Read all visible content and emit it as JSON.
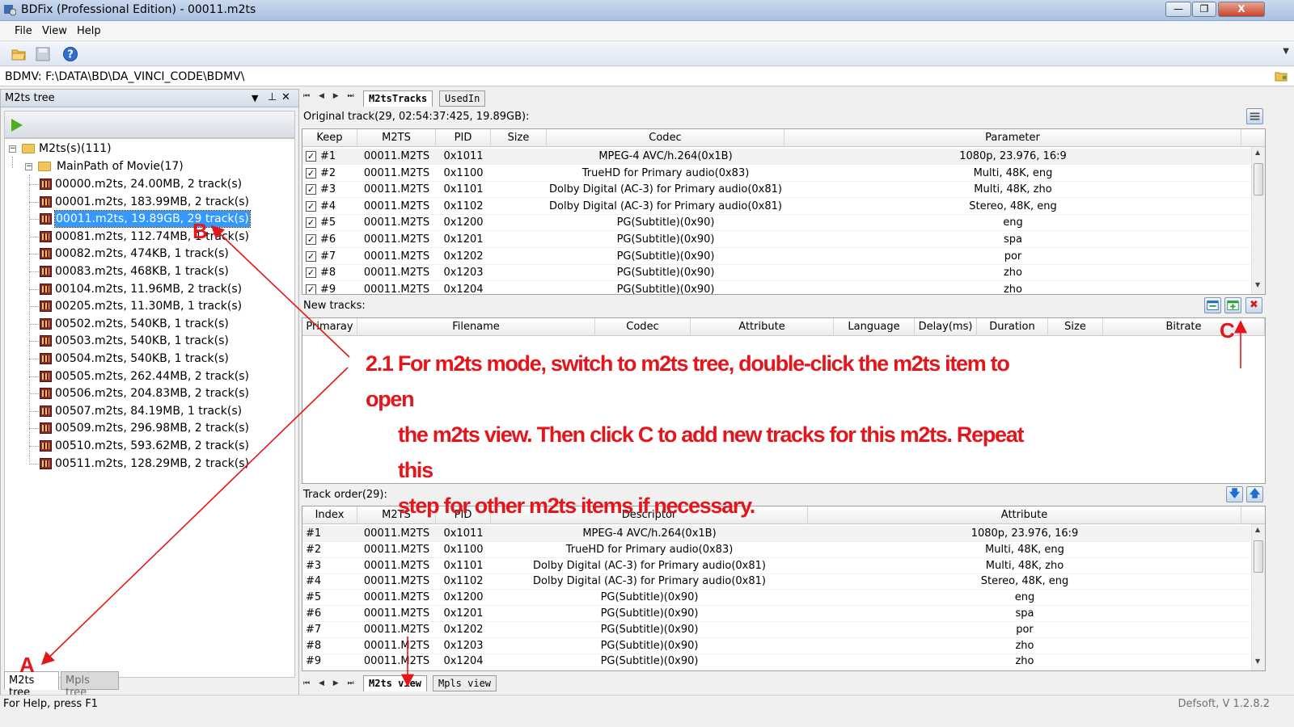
{
  "window": {
    "title": "BDFix (Professional Edition) - 00011.m2ts",
    "minimize": "—",
    "maximize": "❐",
    "close": "X"
  },
  "menu": {
    "file": "File",
    "view": "View",
    "help": "Help"
  },
  "toolbar": {
    "open_icon": "open-folder-icon",
    "save_icon": "save-icon",
    "help_icon": "help-icon",
    "more": "▼"
  },
  "path": {
    "label": "BDMV: F:\\DATA\\BD\\DA_VINCI_CODE\\BDMV\\"
  },
  "left_panel": {
    "title": "M2ts tree",
    "controls": {
      "dropdown": "▼",
      "pin": "⊥",
      "close": "✕"
    },
    "root": {
      "label": "M2ts(s)(111)",
      "expander": "−"
    },
    "group": {
      "label": "MainPath of Movie(17)",
      "expander": "−"
    },
    "items": [
      {
        "label": "00000.m2ts, 24.00MB, 2 track(s)"
      },
      {
        "label": "00001.m2ts, 183.99MB, 2 track(s)"
      },
      {
        "label": "00011.m2ts, 19.89GB, 29 track(s)",
        "selected": true
      },
      {
        "label": "00081.m2ts, 112.74MB, 1 track(s)"
      },
      {
        "label": "00082.m2ts, 474KB, 1 track(s)"
      },
      {
        "label": "00083.m2ts, 468KB, 1 track(s)"
      },
      {
        "label": "00104.m2ts, 11.96MB, 2 track(s)"
      },
      {
        "label": "00205.m2ts, 11.30MB, 1 track(s)"
      },
      {
        "label": "00502.m2ts, 540KB, 1 track(s)"
      },
      {
        "label": "00503.m2ts, 540KB, 1 track(s)"
      },
      {
        "label": "00504.m2ts, 540KB, 1 track(s)"
      },
      {
        "label": "00505.m2ts, 262.44MB, 2 track(s)"
      },
      {
        "label": "00506.m2ts, 204.83MB, 2 track(s)"
      },
      {
        "label": "00507.m2ts, 84.19MB, 1 track(s)"
      },
      {
        "label": "00509.m2ts, 296.98MB, 2 track(s)"
      },
      {
        "label": "00510.m2ts, 593.62MB, 2 track(s)"
      },
      {
        "label": "00511.m2ts, 128.29MB, 2 track(s)"
      }
    ],
    "tabs": {
      "m2ts": "M2ts tree",
      "mpls": "Mpls tree"
    }
  },
  "right_panel": {
    "nav": "⏮ ◀ ▶ ⏭",
    "top_tabs": {
      "m2ts_tracks": "M2tsTracks",
      "used_in": "UsedIn"
    },
    "original": {
      "label": "Original track(29, 02:54:37:425, 19.89GB):",
      "columns": [
        "Keep",
        "M2TS",
        "PID",
        "Size",
        "Codec",
        "Parameter"
      ],
      "rows": [
        {
          "keep": "#1",
          "m2ts": "00011.M2TS",
          "pid": "0x1011",
          "size": "",
          "codec": "MPEG-4 AVC/h.264(0x1B)",
          "param": "1080p, 23.976, 16:9"
        },
        {
          "keep": "#2",
          "m2ts": "00011.M2TS",
          "pid": "0x1100",
          "size": "",
          "codec": "TrueHD for Primary audio(0x83)",
          "param": "Multi, 48K, eng"
        },
        {
          "keep": "#3",
          "m2ts": "00011.M2TS",
          "pid": "0x1101",
          "size": "",
          "codec": "Dolby Digital (AC-3) for Primary audio(0x81)",
          "param": "Multi, 48K, zho"
        },
        {
          "keep": "#4",
          "m2ts": "00011.M2TS",
          "pid": "0x1102",
          "size": "",
          "codec": "Dolby Digital (AC-3) for Primary audio(0x81)",
          "param": "Stereo, 48K, eng"
        },
        {
          "keep": "#5",
          "m2ts": "00011.M2TS",
          "pid": "0x1200",
          "size": "",
          "codec": "PG(Subtitle)(0x90)",
          "param": "eng"
        },
        {
          "keep": "#6",
          "m2ts": "00011.M2TS",
          "pid": "0x1201",
          "size": "",
          "codec": "PG(Subtitle)(0x90)",
          "param": "spa"
        },
        {
          "keep": "#7",
          "m2ts": "00011.M2TS",
          "pid": "0x1202",
          "size": "",
          "codec": "PG(Subtitle)(0x90)",
          "param": "por"
        },
        {
          "keep": "#8",
          "m2ts": "00011.M2TS",
          "pid": "0x1203",
          "size": "",
          "codec": "PG(Subtitle)(0x90)",
          "param": "zho"
        },
        {
          "keep": "#9",
          "m2ts": "00011.M2TS",
          "pid": "0x1204",
          "size": "",
          "codec": "PG(Subtitle)(0x90)",
          "param": "zho"
        }
      ],
      "checkmark": "✓"
    },
    "new_tracks": {
      "label": "New tracks:",
      "columns": [
        "Primaray",
        "Filename",
        "Codec",
        "Attribute",
        "Language",
        "Delay(ms)",
        "Duration",
        "Size",
        "Bitrate"
      ],
      "buttons": {
        "edit_icon": "edit-track-icon",
        "add_icon": "add-track-icon",
        "remove_icon": "remove-track-icon",
        "remove": "✖"
      }
    },
    "track_order": {
      "label": "Track order(29):",
      "columns": [
        "Index",
        "M2TS",
        "PID",
        "Descriptor",
        "Attribute"
      ],
      "buttons": {
        "down": "🡇",
        "up": "🡅"
      },
      "rows": [
        {
          "index": "#1",
          "m2ts": "00011.M2TS",
          "pid": "0x1011",
          "desc": "MPEG-4 AVC/h.264(0x1B)",
          "attr": "1080p, 23.976, 16:9"
        },
        {
          "index": "#2",
          "m2ts": "00011.M2TS",
          "pid": "0x1100",
          "desc": "TrueHD for Primary audio(0x83)",
          "attr": "Multi, 48K, eng"
        },
        {
          "index": "#3",
          "m2ts": "00011.M2TS",
          "pid": "0x1101",
          "desc": "Dolby Digital (AC-3) for Primary audio(0x81)",
          "attr": "Multi, 48K, zho"
        },
        {
          "index": "#4",
          "m2ts": "00011.M2TS",
          "pid": "0x1102",
          "desc": "Dolby Digital (AC-3) for Primary audio(0x81)",
          "attr": "Stereo, 48K, eng"
        },
        {
          "index": "#5",
          "m2ts": "00011.M2TS",
          "pid": "0x1200",
          "desc": "PG(Subtitle)(0x90)",
          "attr": "eng"
        },
        {
          "index": "#6",
          "m2ts": "00011.M2TS",
          "pid": "0x1201",
          "desc": "PG(Subtitle)(0x90)",
          "attr": "spa"
        },
        {
          "index": "#7",
          "m2ts": "00011.M2TS",
          "pid": "0x1202",
          "desc": "PG(Subtitle)(0x90)",
          "attr": "por"
        },
        {
          "index": "#8",
          "m2ts": "00011.M2TS",
          "pid": "0x1203",
          "desc": "PG(Subtitle)(0x90)",
          "attr": "zho"
        },
        {
          "index": "#9",
          "m2ts": "00011.M2TS",
          "pid": "0x1204",
          "desc": "PG(Subtitle)(0x90)",
          "attr": "zho"
        }
      ]
    },
    "bottom_tabs": {
      "m2ts_view": "M2ts view",
      "mpls_view": "Mpls view"
    }
  },
  "status": {
    "left": "For Help, press F1",
    "right": "Defsoft, V 1.2.8.2"
  },
  "annotation": {
    "color": "#e4161b",
    "marker_a": "A",
    "marker_b": "B",
    "marker_c": "C",
    "line1": "2.1 For m2ts mode, switch to m2ts tree, double-click the m2ts item to open",
    "line2": "the m2ts view. Then click C to add new tracks for this m2ts. Repeat  this",
    "line3": "step for other m2ts items if necessary."
  }
}
